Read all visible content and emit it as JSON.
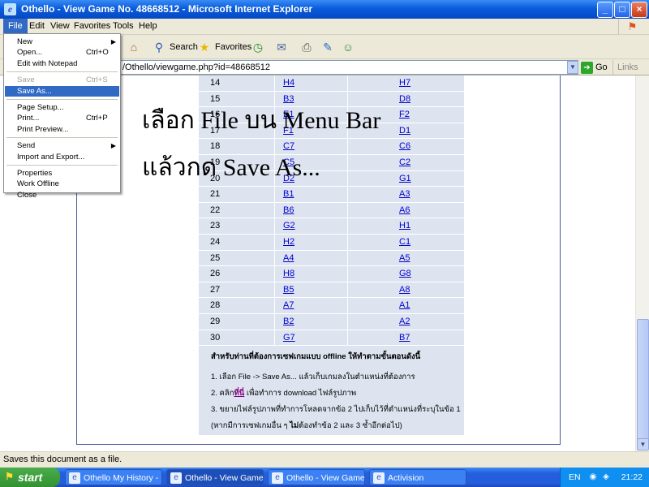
{
  "window": {
    "title": "Othello - View Game No. 48668512 - Microsoft Internet Explorer",
    "controls": {
      "minimize": "_",
      "maximize": "□",
      "close": "×"
    }
  },
  "menubar": {
    "items": [
      "File",
      "Edit",
      "View",
      "Favorites",
      "Tools",
      "Help"
    ]
  },
  "toolbar": {
    "search_label": "Search",
    "favorites_label": "Favorites"
  },
  "address": {
    "url": "/Othello/viewgame.php?id=48668512",
    "go_label": "Go",
    "links_label": "Links"
  },
  "file_menu": {
    "items": [
      {
        "label": "New",
        "shortcut": "",
        "submenu": true,
        "disabled": false,
        "highlighted": false
      },
      {
        "label": "Open...",
        "shortcut": "Ctrl+O",
        "submenu": false,
        "disabled": false,
        "highlighted": false
      },
      {
        "label": "Edit with Notepad",
        "shortcut": "",
        "submenu": false,
        "disabled": false,
        "highlighted": false
      },
      {
        "label": "Save",
        "shortcut": "Ctrl+S",
        "submenu": false,
        "disabled": true,
        "highlighted": false
      },
      {
        "label": "Save As...",
        "shortcut": "",
        "submenu": false,
        "disabled": false,
        "highlighted": true
      },
      {
        "label": "Page Setup...",
        "shortcut": "",
        "submenu": false,
        "disabled": false,
        "highlighted": false
      },
      {
        "label": "Print...",
        "shortcut": "Ctrl+P",
        "submenu": false,
        "disabled": false,
        "highlighted": false
      },
      {
        "label": "Print Preview...",
        "shortcut": "",
        "submenu": false,
        "disabled": false,
        "highlighted": false
      },
      {
        "label": "Send",
        "shortcut": "",
        "submenu": true,
        "disabled": false,
        "highlighted": false
      },
      {
        "label": "Import and Export...",
        "shortcut": "",
        "submenu": false,
        "disabled": false,
        "highlighted": false
      },
      {
        "label": "Properties",
        "shortcut": "",
        "submenu": false,
        "disabled": false,
        "highlighted": false
      },
      {
        "label": "Work Offline",
        "shortcut": "",
        "submenu": false,
        "disabled": false,
        "highlighted": false
      },
      {
        "label": "Close",
        "shortcut": "",
        "submenu": false,
        "disabled": false,
        "highlighted": false
      }
    ]
  },
  "overlay_text": {
    "line1": "เลือก File บน Menu Bar",
    "line2": "แล้วกด Save As..."
  },
  "moves": [
    {
      "n": "14",
      "a": "H4",
      "b": "H7"
    },
    {
      "n": "15",
      "a": "B3",
      "b": "D8"
    },
    {
      "n": "16",
      "a": "E1",
      "b": "F2"
    },
    {
      "n": "17",
      "a": "F1",
      "b": "D1"
    },
    {
      "n": "18",
      "a": "C7",
      "b": "C6"
    },
    {
      "n": "19",
      "a": "C5",
      "b": "C2"
    },
    {
      "n": "20",
      "a": "D2",
      "b": "G1"
    },
    {
      "n": "21",
      "a": "B1",
      "b": "A3"
    },
    {
      "n": "22",
      "a": "B6",
      "b": "A6"
    },
    {
      "n": "23",
      "a": "G2",
      "b": "H1"
    },
    {
      "n": "24",
      "a": "H2",
      "b": "C1"
    },
    {
      "n": "25",
      "a": "A4",
      "b": "A5"
    },
    {
      "n": "26",
      "a": "H8",
      "b": "G8"
    },
    {
      "n": "27",
      "a": "B5",
      "b": "A8"
    },
    {
      "n": "28",
      "a": "A7",
      "b": "A1"
    },
    {
      "n": "29",
      "a": "B2",
      "b": "A2"
    },
    {
      "n": "30",
      "a": "G7",
      "b": "B7"
    }
  ],
  "instructions": {
    "heading": "สำหรับท่านที่ต้องการเซฟเกมแบบ offline ให้ทำตามขั้นตอนดังนี้",
    "step1": "1. เลือก File -> Save As... แล้วเก็บเกมลงในตำแหน่งที่ต้องการ",
    "step2_pre": "2. คลิก",
    "step2_link": "ที่นี่",
    "step2_post": " เพื่อทำการ download ไฟล์รูปภาพ",
    "step3": "3. ขยายไฟล์รูปภาพที่ทำการโหลดจากข้อ 2 ไปเก็บไว้ที่ตำแหน่งที่ระบุในข้อ 1",
    "note_pre": "(หากมีการเซฟเกมอื่น ๆ ",
    "note_bold": "ไม่",
    "note_post": "ต้องทำข้อ 2 และ 3 ซ้ำอีกต่อไป)"
  },
  "status": {
    "text": "Saves this document as a file."
  },
  "taskbar": {
    "start_label": "start",
    "tasks": [
      {
        "label": "Othello My History - ...",
        "active": false
      },
      {
        "label": "Othello - View Game ...",
        "active": true
      },
      {
        "label": "Othello - View Game ...",
        "active": false
      },
      {
        "label": "Activision",
        "active": false
      }
    ],
    "tray": {
      "lang": "EN",
      "clock": "21:22"
    }
  }
}
